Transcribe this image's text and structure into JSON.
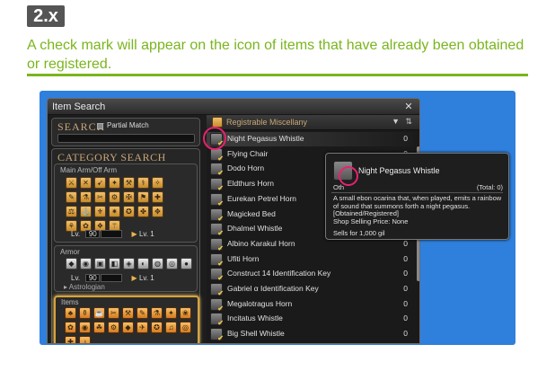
{
  "header": {
    "badge": "2.x",
    "caption": "A check mark will appear on the icon of items that have already been obtained or registered."
  },
  "window": {
    "title": "Item Search",
    "close_icon": "close-icon"
  },
  "search": {
    "title": "SEARCH",
    "partial_match_label": "Partial Match",
    "input_value": ""
  },
  "category": {
    "title": "CATEGORY SEARCH",
    "main_arm_label": "Main Arm/Off Arm",
    "lv_label": "Lv.",
    "lv_value": "90",
    "lv_max_label": "Lv. 1",
    "armor_label": "Armor",
    "armor_lv_value": "90",
    "armor_lv_max_label": "Lv. 1",
    "job_label": "Astrologian",
    "items_label": "Items"
  },
  "results": {
    "header_title": "Registrable Miscellany",
    "rows": [
      {
        "name": "Night Pegasus Whistle",
        "count": "0"
      },
      {
        "name": "Flying Chair",
        "count": "0"
      },
      {
        "name": "Dodo Horn",
        "count": "0"
      },
      {
        "name": "Eldthurs Horn",
        "count": "0"
      },
      {
        "name": "Eurekan Petrel Horn",
        "count": "0"
      },
      {
        "name": "Magicked Bed",
        "count": "0"
      },
      {
        "name": "Dhalmel Whistle",
        "count": "0"
      },
      {
        "name": "Albino Karakul Horn",
        "count": "0"
      },
      {
        "name": "Ufiti Horn",
        "count": "0"
      },
      {
        "name": "Construct 14 Identification Key",
        "count": "0"
      },
      {
        "name": "Gabriel α Identification Key",
        "count": "0"
      },
      {
        "name": "Megalotragus Horn",
        "count": "0"
      },
      {
        "name": "Incitatus Whistle",
        "count": "0"
      },
      {
        "name": "Big Shell Whistle",
        "count": "0"
      }
    ]
  },
  "tooltip": {
    "name": "Night Pegasus Whistle",
    "category": "Oth",
    "total": "(Total: 0)",
    "description": "A small ebon ocarina that, when played, emits a rainbow of sound that summons forth a night pegasus.",
    "status": "[Obtained/Registered]",
    "shop_price": "Shop Selling Price: None",
    "sells_for": "Sells for 1,000 gil"
  },
  "colors": {
    "accent_green": "#7ab51d",
    "highlight_ring": "#e8226e",
    "panel_blue": "#2f7fdc"
  }
}
